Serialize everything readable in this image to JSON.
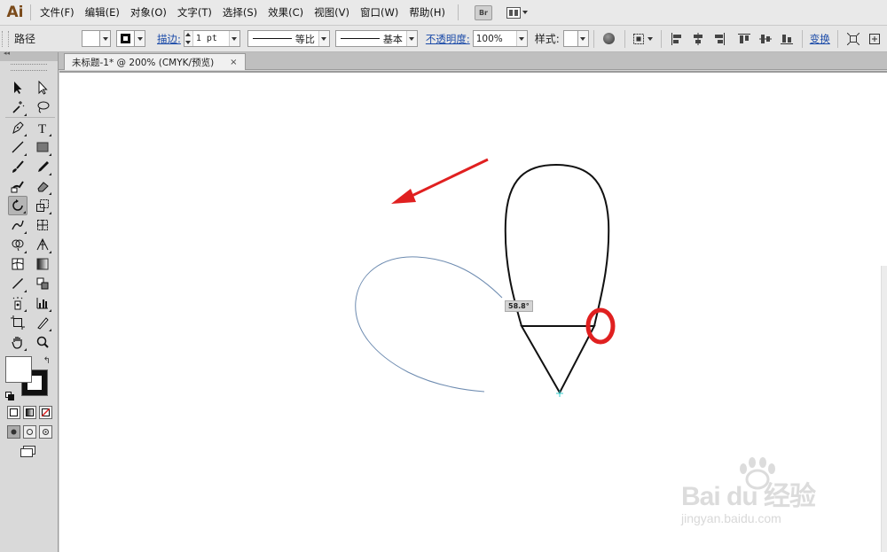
{
  "app": {
    "logo": "Ai"
  },
  "menu": [
    "文件(F)",
    "编辑(E)",
    "对象(O)",
    "文字(T)",
    "选择(S)",
    "效果(C)",
    "视图(V)",
    "窗口(W)",
    "帮助(H)"
  ],
  "menubar_buttons": {
    "bridge": "Br"
  },
  "control": {
    "object_type": "路径",
    "stroke_link": "描边:",
    "stroke_weight": "1 pt",
    "profile_label": "等比",
    "brush_label": "基本",
    "opacity_link": "不透明度:",
    "opacity_value": "100%",
    "style_label": "样式:",
    "transform_link": "变换"
  },
  "document": {
    "tab_title": "未标题-1* @ 200% (CMYK/预览)",
    "close_glyph": "×"
  },
  "canvas": {
    "angle_tooltip": "58.8°",
    "annotation_color": "#e02020"
  },
  "watermark": {
    "brand": "Bai du 经验",
    "url": "jingyan.baidu.com"
  },
  "tools": [
    "selection-tool",
    "direct-selection-tool",
    "magic-wand-tool",
    "lasso-tool",
    "pen-tool",
    "type-tool",
    "line-segment-tool",
    "rectangle-tool",
    "paintbrush-tool",
    "pencil-tool",
    "blob-brush-tool",
    "eraser-tool",
    "rotate-tool",
    "scale-tool",
    "warp-tool",
    "free-transform-tool",
    "shape-builder-tool",
    "perspective-grid-tool",
    "mesh-tool",
    "gradient-tool",
    "eyedropper-tool",
    "blend-tool",
    "symbol-sprayer-tool",
    "column-graph-tool",
    "artboard-tool",
    "slice-tool",
    "hand-tool",
    "zoom-tool"
  ]
}
